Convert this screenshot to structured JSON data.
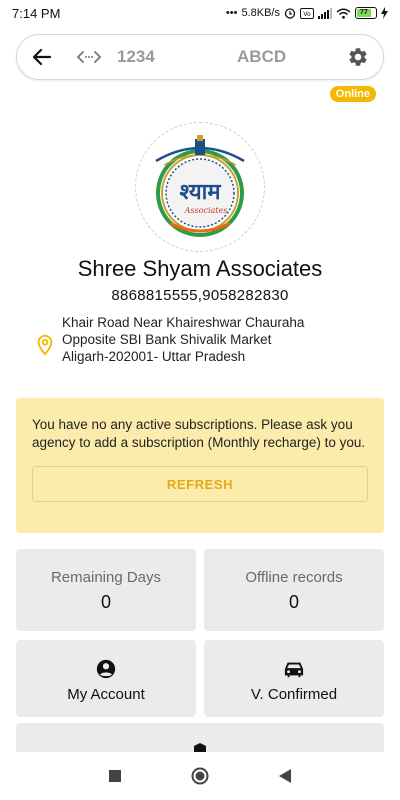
{
  "status_bar": {
    "time": "7:14 PM",
    "net_speed": "5.8KB/s",
    "battery_level": "77"
  },
  "search_bar": {
    "code_value": "1234",
    "text_value": "ABCD"
  },
  "online_badge": "Online",
  "company": {
    "name": "Shree Shyam Associates",
    "phones": "8868815555,9058282830",
    "address_line1": "Khair Road Near Khaireshwar Chauraha",
    "address_line2": "Opposite SBI Bank Shivalik Market",
    "address_line3": "Aligarh-202001- Uttar Pradesh",
    "logo_text": "श्याम",
    "logo_subtext": "Associates"
  },
  "notice": {
    "message": "You have no any active subscriptions. Please ask you agency to add a subscription (Monthly recharge) to you.",
    "refresh_label": "REFRESH"
  },
  "stats": {
    "remaining_days_label": "Remaining Days",
    "remaining_days_value": "0",
    "offline_records_label": "Offline records",
    "offline_records_value": "0"
  },
  "actions": {
    "my_account_label": "My Account",
    "v_confirmed_label": "V. Confirmed"
  },
  "colors": {
    "accent": "#f5b800",
    "notice_bg": "#fcecac",
    "card_bg": "#ebebeb"
  }
}
